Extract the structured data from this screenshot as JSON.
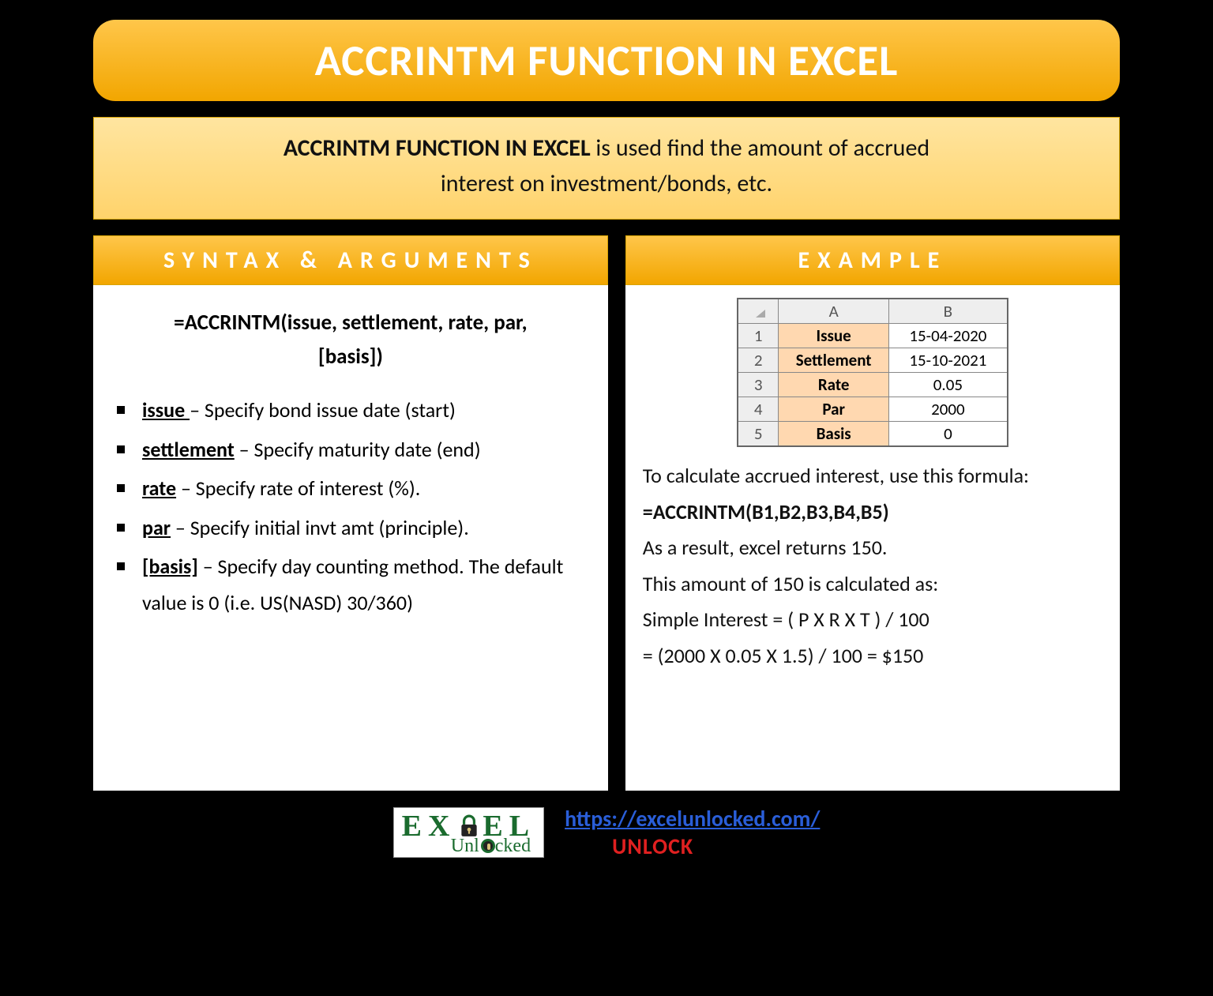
{
  "title": "ACCRINTM FUNCTION IN EXCEL",
  "intro": {
    "lead": "ACCRINTM FUNCTION IN EXCEL",
    "rest1": " is used find the amount of accrued",
    "rest2": "interest on investment/bonds, etc."
  },
  "left": {
    "heading": "SYNTAX & ARGUMENTS",
    "syntax_l1": "=ACCRINTM(issue, settlement, rate, par,",
    "syntax_l2": "[basis])",
    "args": [
      {
        "name": "issue ",
        "desc": " – Specify bond issue date (start)"
      },
      {
        "name": "settlement",
        "desc": " – Specify maturity date (end)"
      },
      {
        "name": "rate",
        "desc": " – Specify rate of interest (%)."
      },
      {
        "name": "par",
        "desc": " – Specify initial invt amt (principle)."
      },
      {
        "name": "[basis]",
        "desc": " – Specify day counting method. The default value is 0 (i.e. US(NASD) 30/360)"
      }
    ]
  },
  "right": {
    "heading": "EXAMPLE",
    "table": {
      "colA": "A",
      "colB": "B",
      "rows": [
        {
          "n": "1",
          "label": "Issue",
          "value": "15-04-2020"
        },
        {
          "n": "2",
          "label": "Settlement",
          "value": "15-10-2021"
        },
        {
          "n": "3",
          "label": "Rate",
          "value": "0.05"
        },
        {
          "n": "4",
          "label": "Par",
          "value": "2000"
        },
        {
          "n": "5",
          "label": "Basis",
          "value": "0"
        }
      ]
    },
    "p1": "To calculate accrued interest, use this formula:",
    "formula": "=ACCRINTM(B1,B2,B3,B4,B5)",
    "p2": "As a result, excel returns 150.",
    "p3": "This amount of 150 is calculated as:",
    "p4": "Simple Interest = ( P X R X T ) / 100",
    "p5": "= (2000 X 0.05 X 1.5) / 100 = $150"
  },
  "footer": {
    "logo_top_pre": "EX",
    "logo_top_post": "EL",
    "logo_bottom": "Unl",
    "logo_bottom2": "cked",
    "url": "https://excelunlocked.com/",
    "unlock": "UNLOCK"
  }
}
